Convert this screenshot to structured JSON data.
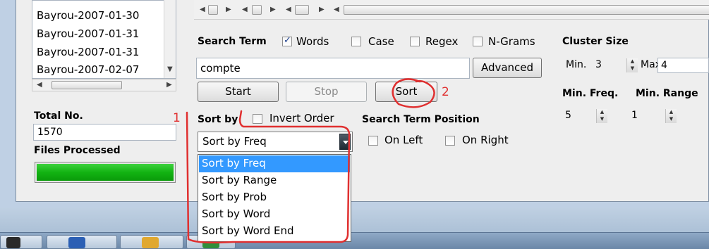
{
  "file_list": {
    "items": [
      "Bayrou-2007-01-30",
      "Bayrou-2007-01-31",
      "Bayrou-2007-01-31",
      "Bayrou-2007-02-07"
    ]
  },
  "total": {
    "label": "Total No.",
    "value": "1570"
  },
  "files_processed": {
    "label": "Files Processed",
    "progress_fraction": 1.0
  },
  "search": {
    "label": "Search Term",
    "options": [
      {
        "label": "Words",
        "checked": true
      },
      {
        "label": "Case",
        "checked": false
      },
      {
        "label": "Regex",
        "checked": false
      },
      {
        "label": "N-Grams",
        "checked": false
      }
    ],
    "value": "compte",
    "advanced_label": "Advanced"
  },
  "buttons": {
    "start": "Start",
    "stop": "Stop",
    "sort": "Sort"
  },
  "cluster": {
    "label": "Cluster Size",
    "min_label": "Min.",
    "min_value": "3",
    "max_label": "Max.",
    "max_value": "4"
  },
  "freq": {
    "min_freq_label": "Min. Freq.",
    "min_range_label": "Min. Range",
    "min_freq_value": "5",
    "min_range_value": "1"
  },
  "sort": {
    "label": "Sort by",
    "invert_label": "Invert Order",
    "invert_checked": false,
    "selected": "Sort by Freq",
    "options": [
      "Sort by Freq",
      "Sort by Range",
      "Sort by Prob",
      "Sort by Word",
      "Sort by Word End"
    ]
  },
  "position": {
    "label": "Search Term Position",
    "on_left": "On Left",
    "on_right": "On Right"
  },
  "annotations": {
    "marker1": "1",
    "marker2": "2"
  },
  "colors": {
    "annotation": "#e03030",
    "selection": "#3399ff",
    "progress": "#12b312"
  }
}
